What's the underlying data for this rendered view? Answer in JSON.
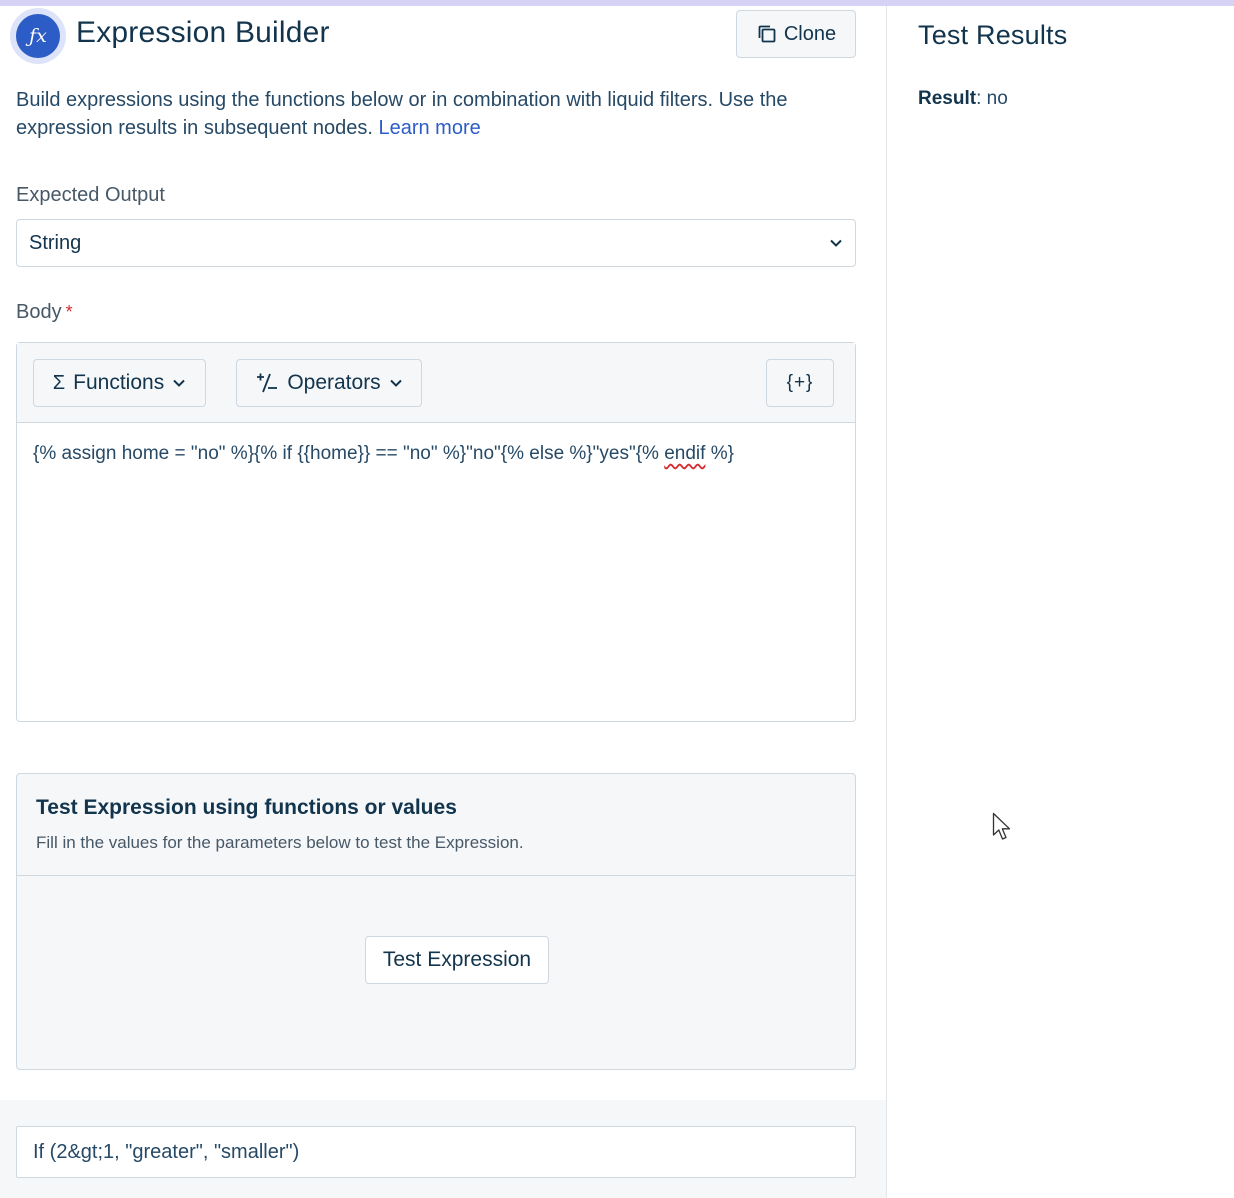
{
  "header": {
    "icon": "fx-icon",
    "title": "Expression Builder",
    "clone_label": "Clone"
  },
  "description": {
    "text": "Build expressions using the functions below or in combination with liquid filters. Use the expression results in subsequent nodes.",
    "link": "Learn more"
  },
  "expected_output": {
    "label": "Expected Output",
    "value": "String"
  },
  "body": {
    "label": "Body",
    "required_mark": "*",
    "functions_label": "Functions",
    "operators_label": "Operators",
    "insert_label": "{+}",
    "code_before": "{% assign home = \"no\" %}{% if {{home}} == \"no\" %}\"no\"{% else %}\"yes\"{% ",
    "code_flagged": "endif",
    "code_after": " %}"
  },
  "test": {
    "title": "Test Expression using functions or values",
    "subtitle": "Fill in the values for the parameters below to test the Expression.",
    "button": "Test Expression"
  },
  "example_input": {
    "value": "If (2&gt;1, \"greater\", \"smaller\")"
  },
  "results": {
    "title": "Test Results",
    "result_label": "Result",
    "result_value": ": no"
  },
  "colors": {
    "accent": "#2c5cc5",
    "text": "#12344d",
    "border": "#cfd7df",
    "panel": "#f5f7f9",
    "required": "#d72d30"
  }
}
